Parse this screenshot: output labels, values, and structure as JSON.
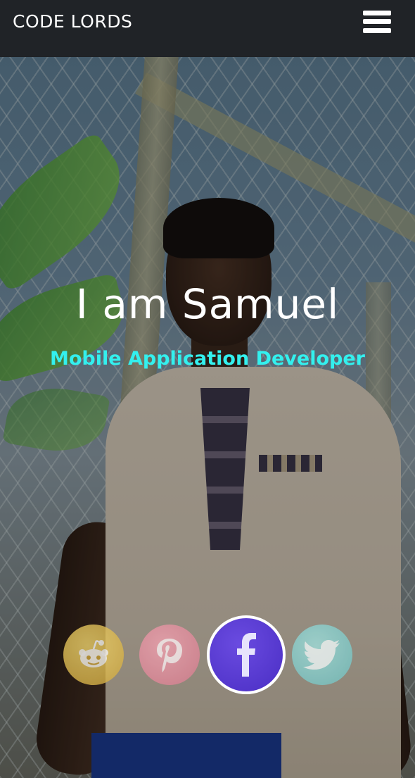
{
  "navbar": {
    "brand": "CODE LORDS",
    "menu_icon": "hamburger-menu-icon"
  },
  "hero": {
    "title": "I am Samuel",
    "subtitle": "Mobile Application Developer",
    "subtitle_color": "#33f0ee"
  },
  "social_links": [
    {
      "name": "reddit",
      "icon": "reddit-icon",
      "color": "#d9b54a"
    },
    {
      "name": "pinterest",
      "icon": "pinterest-icon",
      "color": "#e08fa0"
    },
    {
      "name": "facebook",
      "icon": "facebook-icon",
      "color": "#5a3ad6",
      "active": true
    },
    {
      "name": "twitter",
      "icon": "twitter-icon",
      "color": "#86d0cf"
    }
  ]
}
